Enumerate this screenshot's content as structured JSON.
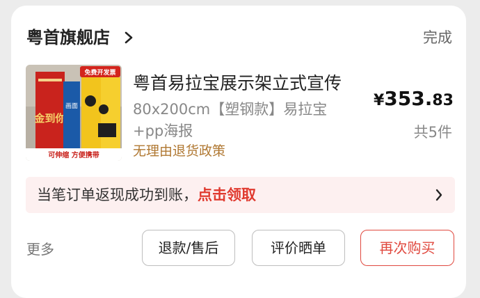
{
  "store": {
    "name": "粤首旗舰店",
    "done_label": "完成"
  },
  "product": {
    "title": "粤首易拉宝展示架立式宣传",
    "spec_line1": "80x200cm【塑钢款】易拉宝",
    "spec_line2": "+pp海报",
    "policy": "无理由退货政策",
    "price_currency": "¥",
    "price_int": "353.",
    "price_dec": "83",
    "quantity": "共5件",
    "image": {
      "badge_text": "免费开发票",
      "sign_left": "金到你",
      "sign_middle": "画面",
      "bottom_text": "可伸缩 方便携带"
    }
  },
  "cashback": {
    "text": "当笔订单返现成功到账，",
    "link": "点击领取"
  },
  "actions": {
    "more_label": "更多",
    "refund_label": "退款/售后",
    "review_label": "评价晒单",
    "rebuy_label": "再次购买"
  },
  "colors": {
    "accent": "#e0483e",
    "policy": "#b07832",
    "cashback_bg": "#fdf0f0"
  }
}
